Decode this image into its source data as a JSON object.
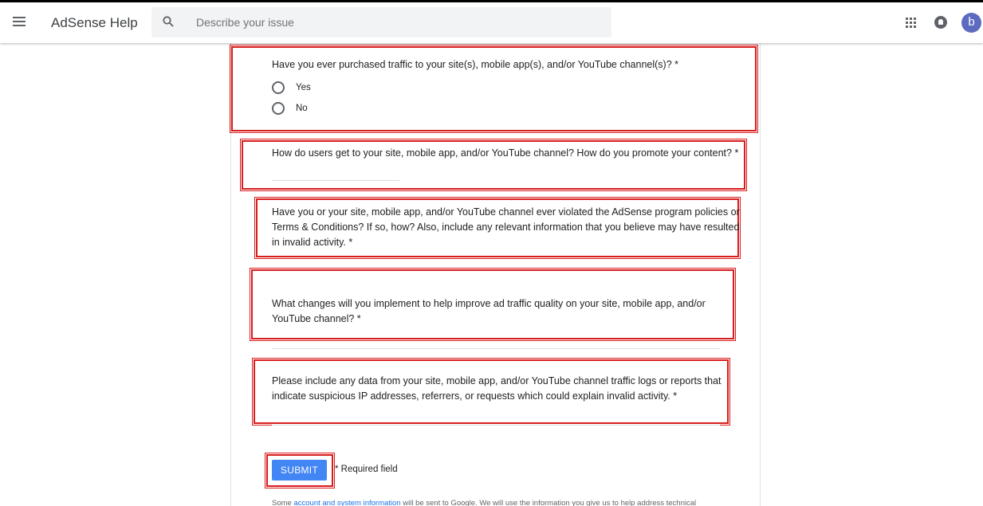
{
  "header": {
    "app_title": "AdSense Help",
    "search_placeholder": "Describe your issue",
    "avatar_letter": "b"
  },
  "form": {
    "q1": {
      "label": "Have you ever purchased traffic to your site(s), mobile app(s), and/or YouTube channel(s)? *",
      "options": [
        "Yes",
        "No"
      ]
    },
    "q2": {
      "label": "How do users get to your site, mobile app, and/or YouTube channel? How do you promote your content? *"
    },
    "q3": {
      "line1": "Have you or your site, mobile app, and/or YouTube channel ever violated the AdSense program policies or",
      "line2": "Terms & Conditions? If so, how? Also, include any relevant information that you believe may have resulted",
      "line3": "in invalid activity. *"
    },
    "q4": {
      "line1": "What changes will you implement to help improve ad traffic quality on your site, mobile app, and/or",
      "line2": "YouTube channel? *"
    },
    "q5": {
      "line1": "Please include any data from your site, mobile app, and/or YouTube channel traffic logs or reports that",
      "line2": "indicate suspicious IP addresses, referrers, or requests which could explain invalid activity. *"
    },
    "submit_label": "SUBMIT",
    "required_note": "* Required field",
    "footer": {
      "prefix": "Some ",
      "link": "account and system information",
      "suffix": " will be sent to Google. We will use the information you give us to help address technical"
    }
  },
  "colors": {
    "highlight_box": "#d91c1c",
    "submit_button": "#4285f4",
    "avatar": "#5c6bc0",
    "link": "#1a73e8"
  }
}
